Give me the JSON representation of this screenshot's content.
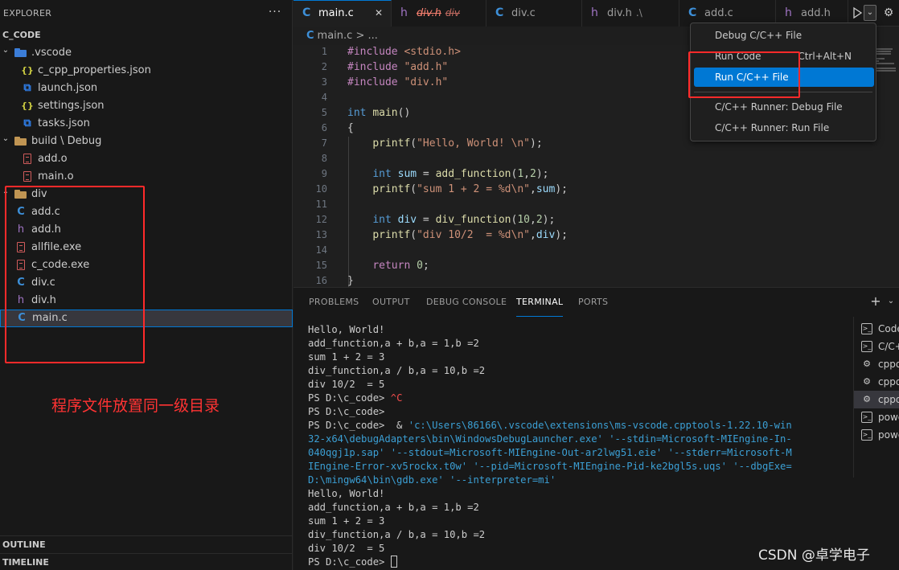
{
  "explorer": {
    "title": "EXPLORER",
    "more": "···",
    "workspace": "C_CODE",
    "items": [
      {
        "label": ".vscode",
        "type": "folder-vscode",
        "depth": 0,
        "expanded": true
      },
      {
        "label": "c_cpp_properties.json",
        "type": "json",
        "depth": 1
      },
      {
        "label": "launch.json",
        "type": "vs",
        "depth": 1
      },
      {
        "label": "settings.json",
        "type": "json",
        "depth": 1
      },
      {
        "label": "tasks.json",
        "type": "vs",
        "depth": 1
      },
      {
        "label": "build \\ Debug",
        "type": "folder",
        "depth": 0,
        "expanded": true
      },
      {
        "label": "add.o",
        "type": "bin",
        "depth": 1
      },
      {
        "label": "main.o",
        "type": "bin",
        "depth": 1
      },
      {
        "label": "div",
        "type": "folder",
        "depth": 0,
        "expanded": true
      },
      {
        "label": "add.c",
        "type": "c",
        "depth": 0
      },
      {
        "label": "add.h",
        "type": "h",
        "depth": 0
      },
      {
        "label": "allfile.exe",
        "type": "bin",
        "depth": 0
      },
      {
        "label": "c_code.exe",
        "type": "bin",
        "depth": 0
      },
      {
        "label": "div.c",
        "type": "c",
        "depth": 0
      },
      {
        "label": "div.h",
        "type": "h",
        "depth": 0
      },
      {
        "label": "main.c",
        "type": "c",
        "depth": 0,
        "selected": true
      }
    ],
    "annotation": "程序文件放置同一级目录",
    "outline": "OUTLINE",
    "timeline": "TIMELINE"
  },
  "tabs": [
    {
      "label": "main.c",
      "icon": "C",
      "active": true,
      "close": "✕"
    },
    {
      "label": "div.h",
      "icon": "h",
      "desc": "div",
      "error": true
    },
    {
      "label": "div.c",
      "icon": "C"
    },
    {
      "label": "div.h",
      "icon": "h",
      "desc": ".\\"
    },
    {
      "label": "add.c",
      "icon": "C"
    },
    {
      "label": "add.h",
      "icon": "h"
    }
  ],
  "breadcrumb": {
    "file": "main.c",
    "sep": ">",
    "rest": "..."
  },
  "editor": {
    "lines": [
      {
        "n": "1",
        "html": "<span class='tok-kw'>#include</span> <span class='tok-inc'>&lt;stdio.h&gt;</span>"
      },
      {
        "n": "2",
        "html": "<span class='tok-kw'>#include</span> <span class='tok-str'>\"add.h\"</span>"
      },
      {
        "n": "3",
        "html": "<span class='tok-kw'>#include</span> <span class='tok-str'>\"div.h\"</span>"
      },
      {
        "n": "4",
        "html": ""
      },
      {
        "n": "5",
        "html": "<span class='tok-type'>int</span> <span class='tok-fn'>main</span>()"
      },
      {
        "n": "6",
        "html": "{"
      },
      {
        "n": "7",
        "html": "    <span class='tok-fn'>printf</span>(<span class='tok-str'>\"Hello, World! \\n\"</span>);"
      },
      {
        "n": "8",
        "html": ""
      },
      {
        "n": "9",
        "html": "    <span class='tok-type'>int</span> <span class='tok-var'>sum</span> = <span class='tok-fn'>add_function</span>(<span class='tok-num'>1</span>,<span class='tok-num'>2</span>);"
      },
      {
        "n": "10",
        "html": "    <span class='tok-fn'>printf</span>(<span class='tok-str'>\"sum 1 + 2 = %d\\n\"</span>,<span class='tok-var'>sum</span>);"
      },
      {
        "n": "11",
        "html": ""
      },
      {
        "n": "12",
        "html": "    <span class='tok-type'>int</span> <span class='tok-var'>div</span> = <span class='tok-fn'>div_function</span>(<span class='tok-num'>10</span>,<span class='tok-num'>2</span>);"
      },
      {
        "n": "13",
        "html": "    <span class='tok-fn'>printf</span>(<span class='tok-str'>\"div 10/2  = %d\\n\"</span>,<span class='tok-var'>div</span>);"
      },
      {
        "n": "14",
        "html": ""
      },
      {
        "n": "15",
        "html": "    <span class='tok-kw'>return</span> <span class='tok-num'>0</span>;"
      },
      {
        "n": "16",
        "html": "}"
      }
    ]
  },
  "run_menu": {
    "items": [
      {
        "label": "Debug C/C++ File",
        "shortcut": ""
      },
      {
        "label": "Run Code",
        "shortcut": "Ctrl+Alt+N"
      },
      {
        "label": "Run C/C++ File",
        "shortcut": "",
        "highlighted": true
      },
      {
        "label": "C/C++ Runner: Debug File",
        "shortcut": ""
      },
      {
        "label": "C/C++ Runner: Run File",
        "shortcut": ""
      }
    ]
  },
  "panel": {
    "tabs": [
      {
        "label": "PROBLEMS"
      },
      {
        "label": "OUTPUT"
      },
      {
        "label": "DEBUG CONSOLE"
      },
      {
        "label": "TERMINAL",
        "active": true
      },
      {
        "label": "PORTS"
      }
    ],
    "add": "+",
    "chev": "⌄",
    "terminal_lines": [
      {
        "parts": [
          {
            "t": "Hello, World!"
          }
        ]
      },
      {
        "parts": [
          {
            "t": "add_function,a + b,a = 1,b =2"
          }
        ]
      },
      {
        "parts": [
          {
            "t": "sum 1 + 2 = 3"
          }
        ]
      },
      {
        "parts": [
          {
            "t": "div_function,a / b,a = 10,b =2"
          }
        ]
      },
      {
        "parts": [
          {
            "t": "div 10/2  = 5"
          }
        ]
      },
      {
        "parts": [
          {
            "t": "PS D:\\c_code> "
          },
          {
            "t": "^C",
            "c": "t-red"
          }
        ]
      },
      {
        "parts": [
          {
            "t": "PS D:\\c_code>"
          }
        ]
      },
      {
        "parts": [
          {
            "t": "PS D:\\c_code>  & "
          },
          {
            "t": "'c:\\Users\\86166\\.vscode\\extensions\\ms-vscode.cpptools-1.22.10-win",
            "c": "t-blue"
          }
        ]
      },
      {
        "parts": [
          {
            "t": "32-x64\\debugAdapters\\bin\\WindowsDebugLauncher.exe'",
            "c": "t-blue"
          },
          {
            "t": " "
          },
          {
            "t": "'--stdin=Microsoft-MIEngine-In-",
            "c": "t-blue"
          }
        ]
      },
      {
        "parts": [
          {
            "t": "040qgj1p.sap'",
            "c": "t-blue"
          },
          {
            "t": " "
          },
          {
            "t": "'--stdout=Microsoft-MIEngine-Out-ar2lwg51.eie'",
            "c": "t-blue"
          },
          {
            "t": " "
          },
          {
            "t": "'--stderr=Microsoft-M",
            "c": "t-blue"
          }
        ]
      },
      {
        "parts": [
          {
            "t": "IEngine-Error-xv5rockx.t0w'",
            "c": "t-blue"
          },
          {
            "t": " "
          },
          {
            "t": "'--pid=Microsoft-MIEngine-Pid-ke2bgl5s.uqs'",
            "c": "t-blue"
          },
          {
            "t": " "
          },
          {
            "t": "'--dbgExe=",
            "c": "t-blue"
          }
        ]
      },
      {
        "parts": [
          {
            "t": "D:\\mingw64\\bin\\gdb.exe'",
            "c": "t-blue"
          },
          {
            "t": " "
          },
          {
            "t": "'--interpreter=mi'",
            "c": "t-blue"
          }
        ]
      },
      {
        "parts": [
          {
            "t": "Hello, World!"
          }
        ]
      },
      {
        "parts": [
          {
            "t": "add_function,a + b,a = 1,b =2"
          }
        ]
      },
      {
        "parts": [
          {
            "t": "sum 1 + 2 = 3"
          }
        ]
      },
      {
        "parts": [
          {
            "t": "div_function,a / b,a = 10,b =2"
          }
        ]
      },
      {
        "parts": [
          {
            "t": "div 10/2  = 5"
          }
        ]
      },
      {
        "parts": [
          {
            "t": "PS D:\\c_code> "
          }
        ],
        "cursor": true
      }
    ],
    "terminals": [
      {
        "label": "Code",
        "icon": "shell"
      },
      {
        "label": "C/C++",
        "icon": "shell"
      },
      {
        "label": "cppdbg",
        "icon": "gear"
      },
      {
        "label": "cppdbg",
        "icon": "gear"
      },
      {
        "label": "cppdbg",
        "icon": "gear",
        "active": true
      },
      {
        "label": "powershell",
        "icon": "shell"
      },
      {
        "label": "powershell",
        "icon": "shell"
      }
    ]
  },
  "watermark": "CSDN @卓学电子"
}
